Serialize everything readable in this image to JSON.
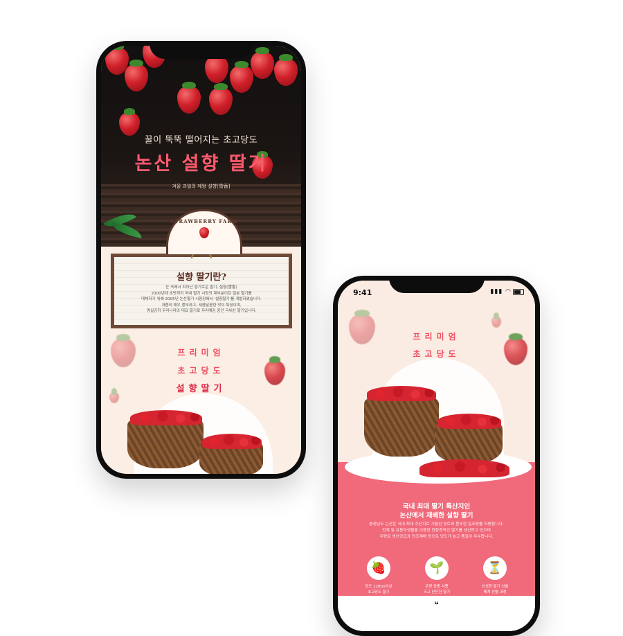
{
  "phone1": {
    "hero": {
      "kicker": "꿀이 뚝뚝 떨어지는 초고당도",
      "title": "논산 설향 딸기",
      "subtitle": "겨울 과일의 제왕 설향[雪香]",
      "badge_text": "STRAWBERRY FARM"
    },
    "info_board": {
      "title": "설향 딸기란?",
      "lines": [
        "눈 속에서 피어난 향기로운 딸기, 설향(雪香)",
        "2000년대 초반까지 국내 딸기 시장의 대부분이던 일본 딸기를",
        "대체하기 위해 2005년 논산딸기 시험장에서 '설향딸기'를 개발하였습니다.",
        "과즙이 매우 풍부하고, 새콤달콤한 맛이 특징이며,",
        "명실공히 우리나라의 대표 딸기로 자리매김 중인 국내산 딸기입니다."
      ]
    },
    "premium": {
      "line1": "프리미엄",
      "line2": "초고당도",
      "line3": "설향딸기"
    }
  },
  "phone2": {
    "status": {
      "time": "9:41",
      "signal": "▮▮▮ ◠"
    },
    "premium": {
      "line1": "프리미엄",
      "line2": "초고당도",
      "line3": "설향딸기"
    },
    "intro": {
      "heading1": "국내 최대 딸기 특산지인",
      "heading2": "논산에서 재배한 설향 딸기",
      "lines": [
        "충청남도 논산은 국내 최대 주산지로 기름진 농토와 풍부한 일조량을 자랑합니다.",
        "전계 및 유용미생물을 이용한 친환경적인 딸기를 생산하고 있으며",
        "우량묘 생산공급과 전조재배 등으로 당도가 높고 품질이 우수합니다."
      ]
    },
    "features": [
      {
        "icon": "🍓",
        "line1": "당도 12Brix이상",
        "line2": "초고당도 딸기"
      },
      {
        "icon": "🌱",
        "line1": "우량 묘종 사용",
        "line2": "크고 단단한 딸기"
      },
      {
        "icon": "⏳",
        "line1": "신선한 딸기 선별",
        "line2": "체계 선별 과정"
      }
    ],
    "footer_quote": "❝"
  },
  "colors": {
    "accent_pink": "#f06a7b",
    "title_red": "#ff5a6e",
    "wood_brown": "#6e4a37"
  }
}
